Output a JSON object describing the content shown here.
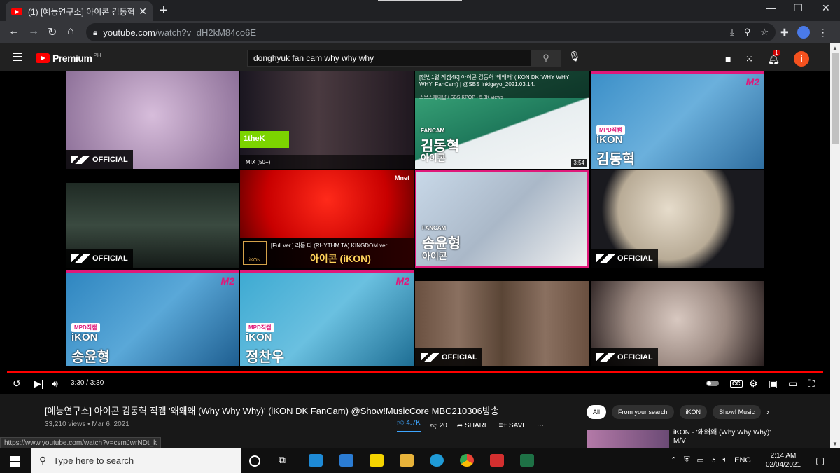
{
  "browser": {
    "tab_title": "(1) [예능연구소] 아이콘 김동혁 직",
    "new_tab": "+",
    "url_host": "youtube.com",
    "url_path": "/watch?v=dH2kM84co6E"
  },
  "youtube": {
    "logo_word": "Premium",
    "logo_region": "PH",
    "search_query": "donghyuk fan cam why why why",
    "notification_count": "1",
    "avatar_letter": "i"
  },
  "endscreen": {
    "official": "OFFICIAL",
    "tile_02_badge": "1theK",
    "tile_02_mix": "MIX (50+)",
    "tile_03_title": "[안방1열 직캠4K] 아이콘 김동혁 '왜왜왜' (iKON DK 'WHY WHY WHY' FanCam) | @SBS Inkigayo_2021.03.14.",
    "tile_03_channel": "스브스케이팝 / SBS KPOP · 5.3K views",
    "tile_03_fancam": "FANCAM",
    "tile_03_name": "김동혁",
    "tile_03_group": "아이콘",
    "tile_03_time": "3:54",
    "mpd_label": "MPD직캠",
    "tile_04_group": "iKON",
    "tile_04_name": "김동혁",
    "tile_06_line1": "[Full ver.] 리듬 타 (RHYTHM TA) KINGDOM ver.",
    "tile_06_line2": "아이콘 (iKON)",
    "tile_07_fancam": "FANCAM",
    "tile_07_name": "송윤형",
    "tile_07_group": "아이콘",
    "tile_09_group": "iKON",
    "tile_09_name": "송윤형",
    "tile_10_group": "iKON",
    "tile_10_name": "정찬우"
  },
  "player": {
    "timecode": "3:30 / 3:30",
    "progress": 1.0
  },
  "video": {
    "title": "[예능연구소] 아이콘 김동혁 직캠 '왜왜왜 (Why Why Why)' (iKON DK FanCam) @Show!MusicCore MBC210306방송",
    "meta": "33,210 views • Mar 6, 2021",
    "likes": "4.7K",
    "dislikes": "20",
    "share": "SHARE",
    "save": "SAVE"
  },
  "chips": [
    "All",
    "From your search",
    "iKON",
    "Show! Music"
  ],
  "recommended": {
    "title": "iKON - '왜왜왜 (Why Why Why)' M/V"
  },
  "status_url": "https://www.youtube.com/watch?v=csmJwrNDt_k",
  "taskbar": {
    "search_placeholder": "Type here to search",
    "lang": "ENG",
    "time": "2:14 AM",
    "date": "02/04/2021"
  },
  "colors": {
    "accent": "#ff0000",
    "like_blue": "#3ea6ff",
    "m2_pink": "#e0187a"
  }
}
